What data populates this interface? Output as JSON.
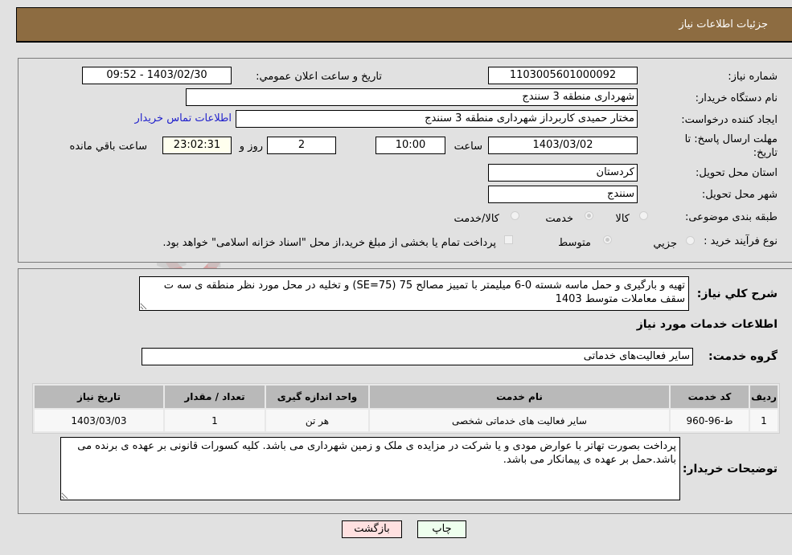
{
  "header": {
    "title": "جزئیات اطلاعات نیاز"
  },
  "form": {
    "need_number_label": "شماره نیاز:",
    "need_number": "1103005601000092",
    "announce_label": "تاریخ و ساعت اعلان عمومي:",
    "announce_value": "1403/02/30 - 09:52",
    "buyer_org_label": "نام دستگاه خریدار:",
    "buyer_org": "شهرداری منطقه 3 سنندج",
    "creator_label": "ایجاد کننده درخواست:",
    "creator": "مختار حمیدی کاربرداز شهرداری منطقه 3 سنندج",
    "contact_link": "اطلاعات تماس خریدار",
    "deadline_label_line1": "مهلت ارسال پاسخ: تا",
    "deadline_label_line2": "تاریخ:",
    "deadline_date": "1403/03/02",
    "time_label": "ساعت",
    "deadline_time": "10:00",
    "days_value": "2",
    "days_label": "روز و",
    "remaining_time": "23:02:31",
    "remaining_label": "ساعت باقي مانده",
    "province_label": "استان محل تحویل:",
    "province": "کردستان",
    "city_label": "شهر محل تحویل:",
    "city": "سنندج",
    "category_label": "طبقه بندی موضوعی:",
    "category_options": [
      {
        "label": "کالا",
        "selected": false
      },
      {
        "label": "خدمت",
        "selected": true
      },
      {
        "label": "کالا/خدمت",
        "selected": false
      }
    ],
    "process_label": "نوع فرآیند خرید :",
    "process_options": [
      {
        "label": "جزيي",
        "selected": false
      },
      {
        "label": "متوسط",
        "selected": true
      }
    ],
    "treasury_note": "پرداخت تمام یا بخشی از مبلغ خرید،از محل \"اسناد خزانه اسلامی\" خواهد بود.",
    "treasury_checked": false
  },
  "details": {
    "description_label": "شرح کلي نیاز:",
    "description": "تهیه و بارگیری و حمل ماسه شسته 0-6 میلیمتر با تمییز مصالح 75 (SE=75) و تخلیه در محل مورد نظر منطقه ی سه ت سقف معاملات متوسط 1403",
    "services_heading": "اطلاعات خدمات مورد نیاز",
    "service_group_label": "گروه خدمت:",
    "service_group": "سایر فعالیت‌های خدماتی",
    "table": {
      "headers": [
        "ردیف",
        "کد خدمت",
        "نام خدمت",
        "واحد اندازه گیری",
        "تعداد / مقدار",
        "تاریخ نیاز"
      ],
      "rows": [
        [
          "1",
          "ط-96-960",
          "سایر فعالیت های خدماتی شخصی",
          "هر تن",
          "1",
          "1403/03/03"
        ]
      ]
    },
    "buyer_notes_label": "توضیحات خریدار:",
    "buyer_notes": "پرداخت بصورت تهاتر با عوارض مودی و یا شرکت در مزایده ی ملک و زمین شهرداری می باشد. کلیه کسورات قانونی بر عهده ی برنده می باشد.حمل بر عهده ی پیمانکار می باشد."
  },
  "buttons": {
    "print": "چاپ",
    "back": "بازگشت"
  },
  "watermark": {
    "text": "AriaTender.neT"
  },
  "colors": {
    "header_bg": "#8d6c41",
    "print_bg": "#eeffee",
    "back_bg": "#ffe0e0",
    "link": "#2222cc"
  }
}
